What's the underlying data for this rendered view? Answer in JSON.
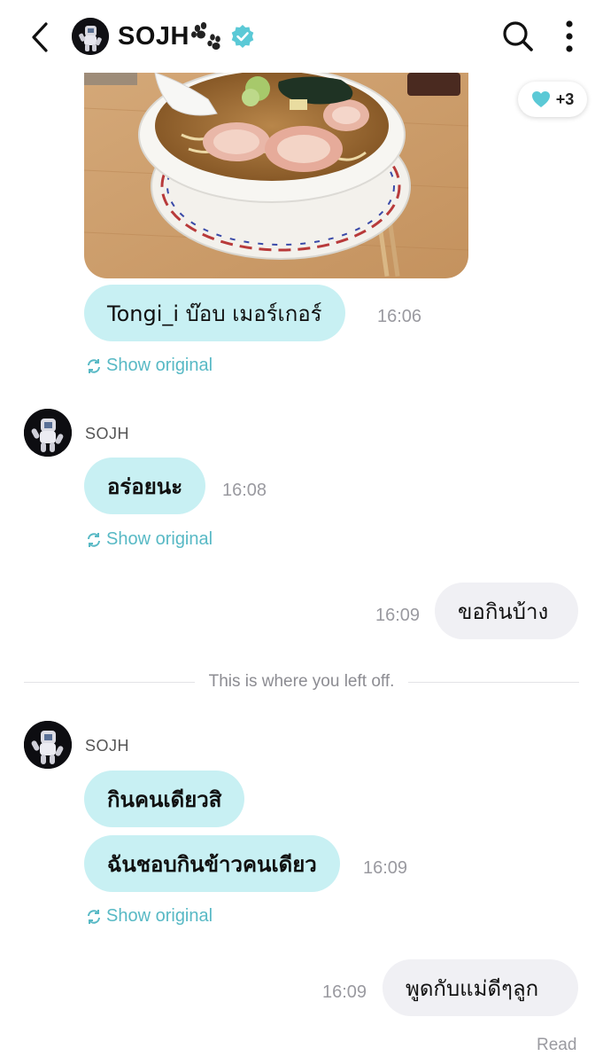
{
  "header": {
    "title": "SOJH",
    "icons": {
      "back": "chevron-left-icon",
      "paw": "paw-icon",
      "verified": "verified-badge-icon",
      "search": "search-icon",
      "more": "more-vertical-icon"
    }
  },
  "reaction": {
    "icon": "heart-icon",
    "count": "+3",
    "color": "#5bc9d6"
  },
  "messages": {
    "m1": {
      "text": "Tongi_i บ๊อบ เมอร์เกอร์",
      "time": "16:06",
      "show_original": "Show original"
    },
    "m2": {
      "sender": "SOJH",
      "text": "อร่อยนะ",
      "time": "16:08",
      "show_original": "Show original"
    },
    "m3": {
      "text": "ขอกินบ้าง",
      "time": "16:09"
    },
    "divider": "This is where you left off.",
    "m4": {
      "sender": "SOJH",
      "text_1": "กินคนเดียวสิ",
      "text_2": "ฉันชอบกินข้าวคนเดียว",
      "time": "16:09",
      "show_original": "Show original"
    },
    "m5": {
      "text": "พูดกับแม่ดีๆลูก",
      "time": "16:09",
      "status": "Read"
    }
  },
  "colors": {
    "incoming_bubble": "#c8f0f3",
    "outgoing_bubble": "#f0f0f4",
    "accent": "#58b9c5"
  }
}
